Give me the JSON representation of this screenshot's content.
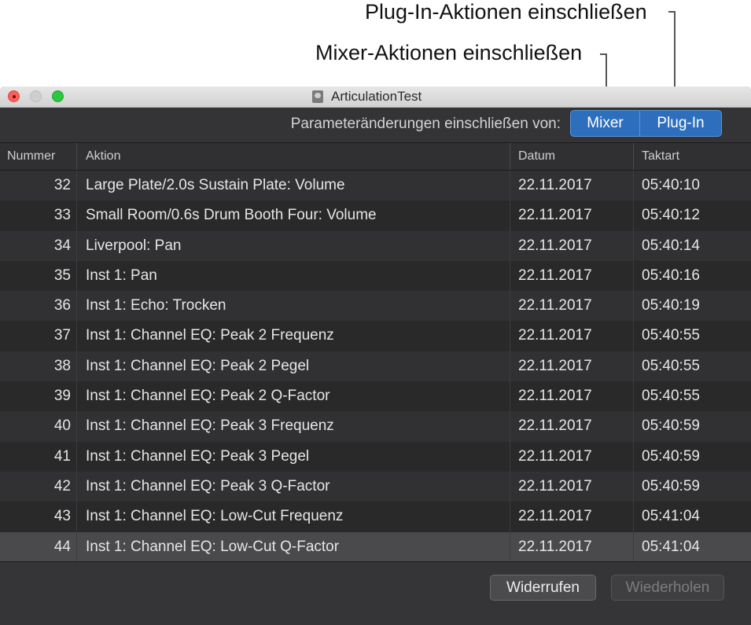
{
  "callouts": {
    "plugin_label": "Plug-In-Aktionen einschließen",
    "mixer_label": "Mixer-Aktionen einschließen"
  },
  "window": {
    "title": "ArticulationTest"
  },
  "toolbar": {
    "filter_label": "Parameteränderungen einschließen von:",
    "mixer_button": "Mixer",
    "plugin_button": "Plug-In"
  },
  "table": {
    "columns": [
      "Nummer",
      "Aktion",
      "Datum",
      "Taktart"
    ],
    "rows": [
      {
        "num": "32",
        "action": "Large Plate/2.0s Sustain Plate: Volume",
        "date": "22.11.2017",
        "time": "05:40:10"
      },
      {
        "num": "33",
        "action": "Small Room/0.6s Drum Booth Four: Volume",
        "date": "22.11.2017",
        "time": "05:40:12"
      },
      {
        "num": "34",
        "action": "Liverpool: Pan",
        "date": "22.11.2017",
        "time": "05:40:14"
      },
      {
        "num": "35",
        "action": "Inst 1: Pan",
        "date": "22.11.2017",
        "time": "05:40:16"
      },
      {
        "num": "36",
        "action": "Inst 1: Echo: Trocken",
        "date": "22.11.2017",
        "time": "05:40:19"
      },
      {
        "num": "37",
        "action": "Inst 1: Channel EQ: Peak 2 Frequenz",
        "date": "22.11.2017",
        "time": "05:40:55"
      },
      {
        "num": "38",
        "action": "Inst 1: Channel EQ: Peak 2 Pegel",
        "date": "22.11.2017",
        "time": "05:40:55"
      },
      {
        "num": "39",
        "action": "Inst 1: Channel EQ: Peak 2 Q-Factor",
        "date": "22.11.2017",
        "time": "05:40:55"
      },
      {
        "num": "40",
        "action": "Inst 1: Channel EQ: Peak 3 Frequenz",
        "date": "22.11.2017",
        "time": "05:40:59"
      },
      {
        "num": "41",
        "action": "Inst 1: Channel EQ: Peak 3 Pegel",
        "date": "22.11.2017",
        "time": "05:40:59"
      },
      {
        "num": "42",
        "action": "Inst 1: Channel EQ: Peak 3 Q-Factor",
        "date": "22.11.2017",
        "time": "05:40:59"
      },
      {
        "num": "43",
        "action": "Inst 1: Channel EQ: Low-Cut Frequenz",
        "date": "22.11.2017",
        "time": "05:41:04"
      },
      {
        "num": "44",
        "action": "Inst 1: Channel EQ: Low-Cut Q-Factor",
        "date": "22.11.2017",
        "time": "05:41:04"
      }
    ]
  },
  "footer": {
    "undo_button": "Widerrufen",
    "redo_button": "Wiederholen"
  },
  "colors": {
    "accent": "#2e6fbd",
    "window_bg": "#2c2c2d"
  }
}
